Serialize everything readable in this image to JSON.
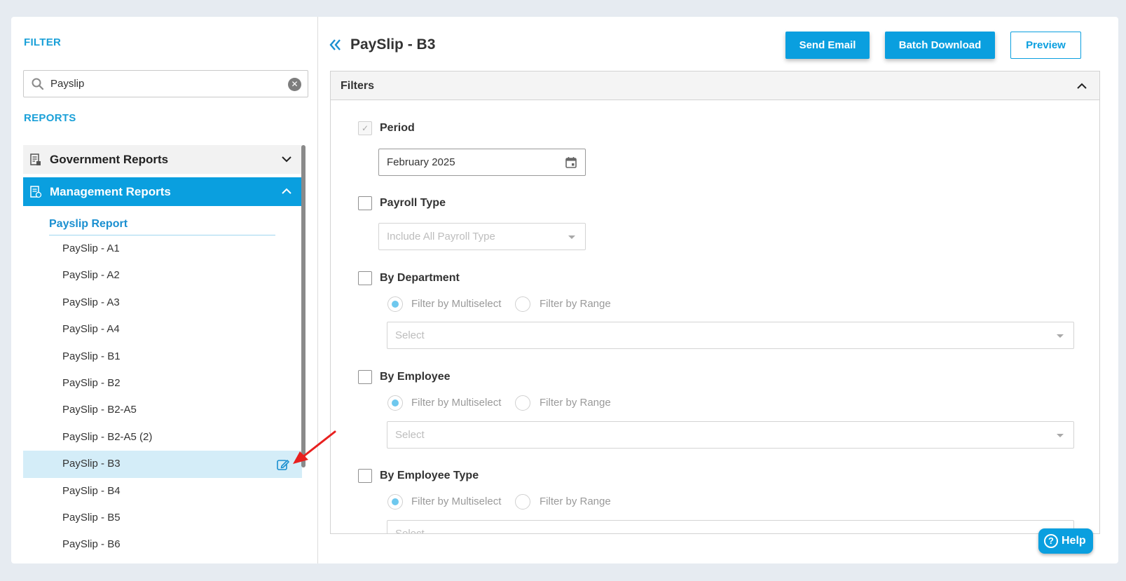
{
  "sidebar": {
    "filter_label": "FILTER",
    "search_value": "Payslip",
    "reports_label": "REPORTS",
    "groups": [
      {
        "label": "Government Reports",
        "expanded": false
      },
      {
        "label": "Management Reports",
        "expanded": true
      }
    ],
    "subgroup_label": "Payslip Report",
    "items": [
      {
        "label": "PaySlip - A1"
      },
      {
        "label": "PaySlip - A2"
      },
      {
        "label": "PaySlip - A3"
      },
      {
        "label": "PaySlip - A4"
      },
      {
        "label": "PaySlip - B1"
      },
      {
        "label": "PaySlip - B2"
      },
      {
        "label": "PaySlip - B2-A5"
      },
      {
        "label": "PaySlip - B2-A5 (2)"
      },
      {
        "label": "PaySlip - B3",
        "active": true
      },
      {
        "label": "PaySlip - B4"
      },
      {
        "label": "PaySlip - B5"
      },
      {
        "label": "PaySlip - B6"
      }
    ]
  },
  "header": {
    "title": "PaySlip - B3",
    "send_email": "Send Email",
    "batch_download": "Batch Download",
    "preview": "Preview"
  },
  "filters": {
    "title": "Filters",
    "period": {
      "label": "Period",
      "value": "February 2025",
      "checked": true
    },
    "payroll_type": {
      "label": "Payroll Type",
      "placeholder": "Include All Payroll Type"
    },
    "by_department": {
      "label": "By Department",
      "opt_multi": "Filter by Multiselect",
      "opt_range": "Filter by Range",
      "placeholder": "Select"
    },
    "by_employee": {
      "label": "By Employee",
      "opt_multi": "Filter by Multiselect",
      "opt_range": "Filter by Range",
      "placeholder": "Select"
    },
    "by_employee_type": {
      "label": "By Employee Type",
      "opt_multi": "Filter by Multiselect",
      "opt_range": "Filter by Range",
      "placeholder": "Select"
    }
  },
  "help": {
    "label": "Help"
  },
  "colors": {
    "accent": "#0a9fdf",
    "active_row": "#d4edf8",
    "annotation_arrow": "#e8201f"
  }
}
